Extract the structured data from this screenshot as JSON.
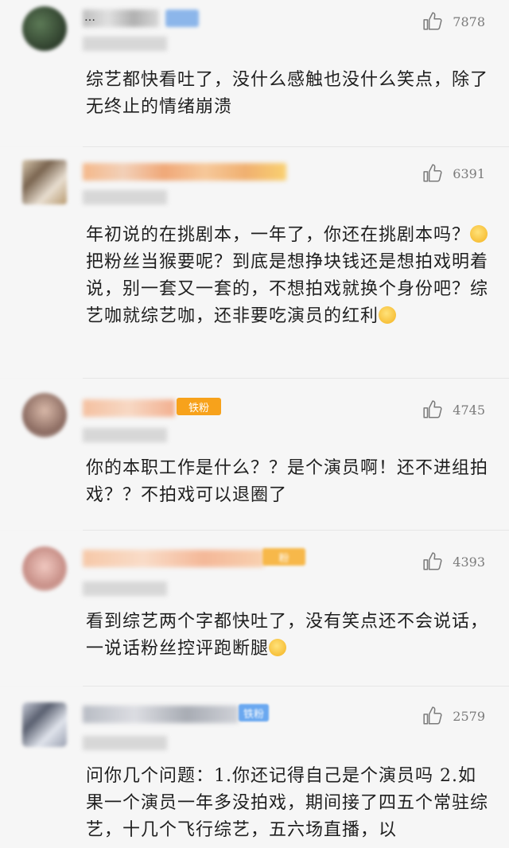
{
  "comments": [
    {
      "name": "…",
      "likes": "7878",
      "badge": "",
      "text": "综艺都快看吐了，没什么感触也没什么笑点，除了无终止的情绪崩溃"
    },
    {
      "name": "",
      "likes": "6391",
      "badge": "",
      "text_parts": [
        "年初说的在挑剧本，一年了，你还在挑剧本吗？",
        "把粉丝当猴要呢？到底是想挣块钱还是想拍戏明着说，别一套又一套的，不想拍戏就换个身份吧？综艺咖就综艺咖，还非要吃演员的红利"
      ]
    },
    {
      "name": "",
      "likes": "4745",
      "badge": "铁粉",
      "text": "你的本职工作是什么？？是个演员啊！还不进组拍戏？？不拍戏可以退圈了"
    },
    {
      "name": "",
      "likes": "4393",
      "badge": "粉",
      "text": "看到综艺两个字都快吐了，没有笑点还不会说话，一说话粉丝控评跑断腿"
    },
    {
      "name": "",
      "likes": "2579",
      "badge": "铁粉",
      "text": "问你几个问题：1.你还记得自己是个演员吗 2.如果一个演员一年多没拍戏，期间接了四五个常驻综艺，十几个飞行综艺，五六场直播，以"
    }
  ],
  "colors": {
    "badge_orange": "#f7a21b",
    "badge_blue": "#6aa8f0",
    "like_gray": "#7a7a7a"
  },
  "icons": {
    "like": "thumbs-up-icon",
    "emoji_smirk": "smirk-emoji-icon",
    "emoji_flushed": "flushed-emoji-icon"
  }
}
